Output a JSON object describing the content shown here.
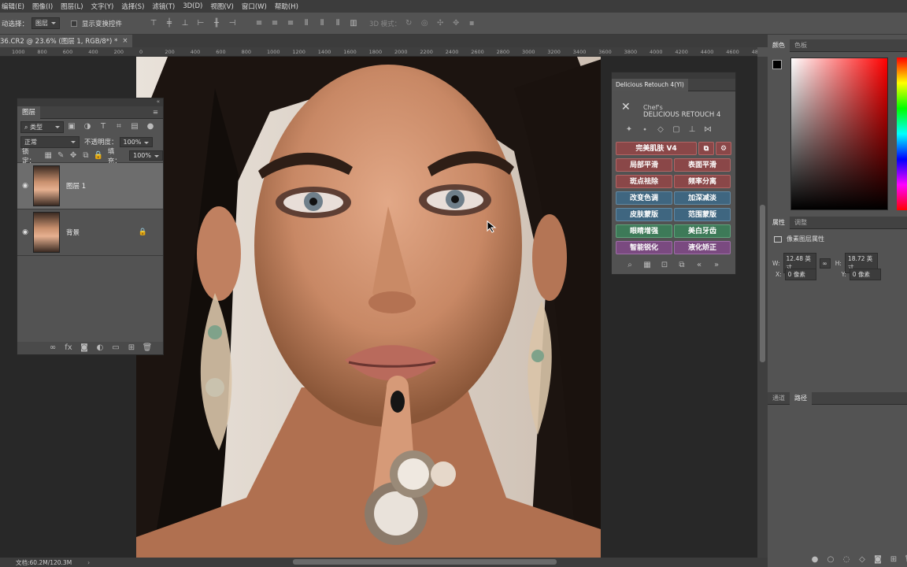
{
  "menu": [
    "编辑(E)",
    "图像(I)",
    "图层(L)",
    "文字(Y)",
    "选择(S)",
    "滤镜(T)",
    "3D(D)",
    "视图(V)",
    "窗口(W)",
    "帮助(H)"
  ],
  "options": {
    "auto_select_label": "动选择：",
    "auto_select_value": "图层",
    "transform_label": "显示变换控件",
    "mode_3d": "3D 模式："
  },
  "document_tab": "36.CR2 @ 23.6% (图层 1, RGB/8*) *",
  "ruler_ticks": [
    "1000",
    "800",
    "600",
    "400",
    "200",
    "0",
    "200",
    "400",
    "600",
    "800",
    "1000",
    "1200",
    "1400",
    "1600",
    "1800",
    "2000",
    "2200",
    "2400",
    "2600",
    "2800",
    "3000",
    "3200",
    "3400",
    "3600",
    "3800",
    "4000",
    "4200",
    "4400",
    "4600",
    "4800"
  ],
  "status": {
    "doc_info": "文档:60.2M/120.3M"
  },
  "layers_panel": {
    "tab": "图层",
    "filter_type": "类型",
    "blend_mode": "正常",
    "opacity_label": "不透明度：",
    "opacity_value": "100%",
    "lock_label": "锁定：",
    "fill_label": "填充：",
    "fill_value": "100%",
    "layers": [
      {
        "name": "图层 1",
        "selected": true
      },
      {
        "name": "背景",
        "selected": false,
        "locked": true
      }
    ]
  },
  "retouch_panel": {
    "tab": "Delicious Retouch 4(YI)",
    "brand_small": "Chef's",
    "brand_big": "DELICIOUS RETOUCH 4",
    "buttons": [
      {
        "label": "完美肌肤 V4",
        "color": "red"
      },
      {
        "label": "局部平滑",
        "color": "red"
      },
      {
        "label": "表面平滑",
        "color": "red"
      },
      {
        "label": "斑点祛除",
        "color": "red"
      },
      {
        "label": "频率分离",
        "color": "red"
      },
      {
        "label": "改变色调",
        "color": "blue"
      },
      {
        "label": "加深减淡",
        "color": "blue"
      },
      {
        "label": "皮肤蒙版",
        "color": "blue"
      },
      {
        "label": "范围蒙版",
        "color": "blue"
      },
      {
        "label": "眼睛增强",
        "color": "green"
      },
      {
        "label": "美白牙齿",
        "color": "green"
      },
      {
        "label": "智能锐化",
        "color": "purple"
      },
      {
        "label": "液化矫正",
        "color": "purple"
      }
    ]
  },
  "color_panel": {
    "tabs": [
      "颜色",
      "色板"
    ]
  },
  "properties_panel": {
    "tabs": [
      "属性",
      "调整"
    ],
    "title": "像素图层属性",
    "w_label": "W:",
    "w_value": "12.48 英寸",
    "h_label": "H:",
    "h_value": "18.72 英寸",
    "x_label": "X:",
    "x_value": "0 像素",
    "y_label": "Y:",
    "y_value": "0 像素"
  },
  "paths_panel": {
    "tabs": [
      "通道",
      "路径"
    ]
  }
}
